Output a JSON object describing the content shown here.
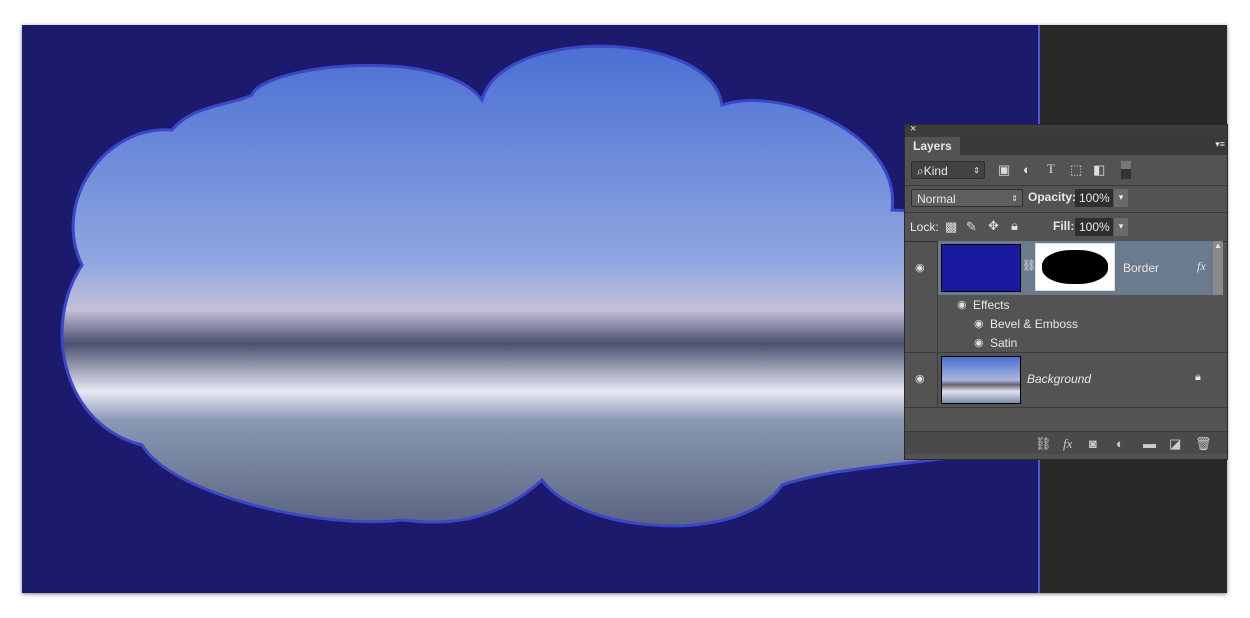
{
  "panel": {
    "close": "×",
    "tab": "Layers",
    "menu": "▾≡",
    "filter": {
      "label": "Kind",
      "icon": "search-icon"
    },
    "blend_mode": "Normal",
    "opacity_label": "Opacity:",
    "opacity": "100%",
    "lock_label": "Lock:",
    "fill_label": "Fill:",
    "fill": "100%",
    "layers": [
      {
        "name": "Border",
        "fx": "fx",
        "color": "#1a1aa0",
        "effects_label": "Effects",
        "effects": [
          "Bevel & Emboss",
          "Satin"
        ]
      },
      {
        "name": "Background",
        "locked": true
      }
    ]
  },
  "colors": {
    "canvas": "#1b1a6d",
    "layer_fill": "#1a1aa0",
    "selected_row": "#6a7b8e"
  }
}
